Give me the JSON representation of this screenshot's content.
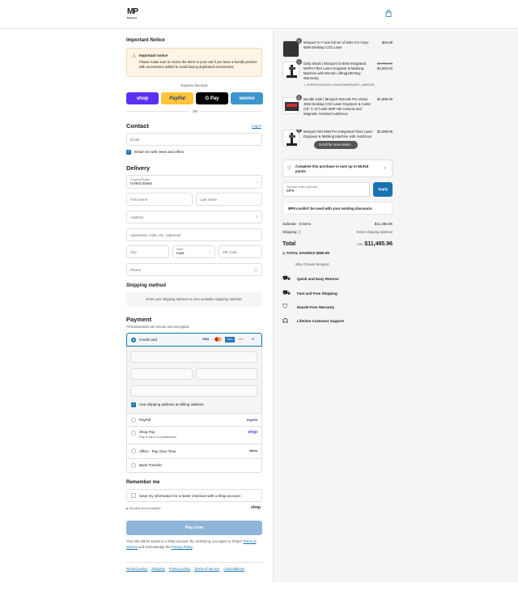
{
  "header": {
    "logo_mark": "MP",
    "logo_text": "Monport"
  },
  "notice": {
    "heading": "Important Notice",
    "box_title": "Important notice",
    "box_text": "Please make sure to review the items in your cart if you have a bundle product with accessories added to avoid buying duplicated accessories."
  },
  "express": {
    "label": "Express checkout",
    "or": "OR",
    "shop": "shop",
    "paypal": "PayPal",
    "gpay": "G Pay",
    "venmo": "venmo"
  },
  "contact": {
    "heading": "Contact",
    "login": "Log in",
    "email_placeholder": "Email",
    "news_label": "Email me with news and offers"
  },
  "delivery": {
    "heading": "Delivery",
    "country_label": "Country/Region",
    "country": "United States",
    "first": "First name",
    "last": "Last name",
    "address": "Address",
    "apt": "Apartment, suite, etc. (optional)",
    "city": "City",
    "state_label": "State",
    "state": "Iowa",
    "zip": "ZIP code",
    "phone": "Phone"
  },
  "shipping": {
    "heading": "Shipping method",
    "msg": "Enter your shipping address to view available shipping methods."
  },
  "payment": {
    "heading": "Payment",
    "sub": "All transactions are secure and encrypted.",
    "credit": "Credit card",
    "cards": [
      "VISA",
      "MC",
      "AMEX",
      "DISC",
      "+4"
    ],
    "billing": "Use shipping address as billing address.",
    "paypal": "PayPal",
    "paypal_logo": "PayPal",
    "shoppay": "Shop Pay",
    "shoppay_sub": "Pay in full or in installments",
    "shoppay_logo": "shop",
    "affirm": "Affirm - Pay Over Time",
    "affirm_logo": "affirm",
    "bank": "Bank Transfer"
  },
  "remember": {
    "heading": "Remember me",
    "label": "Save my information for a faster checkout with a Shop account",
    "secure": "Secured and encrypted",
    "shop": "shop"
  },
  "paynow": "Pay now",
  "legal": {
    "text1": "Your info will be saved to a Shop account. By continuing, you agree to Shop's",
    "tos": "Terms of Service",
    "text2": "and acknowledge the",
    "privacy": "Privacy Policy",
    "end": "."
  },
  "footer": [
    "Refund policy",
    "Shipping",
    "Privacy policy",
    "Terms of service",
    "Cancellations"
  ],
  "cart": [
    {
      "qty": "1",
      "name": "Monport X-Y axis full set of belts For Onyx 55W Desktop CO2 Laser",
      "price": "$45.99"
    },
    {
      "qty": "1",
      "name": "Daily Deals | Monport GI 60W Integrated MOPA Fiber Laser Engraver & Marking Machine with Electric Lifting(180-Day Warranty)",
      "old": "$4,759.99",
      "price": "$3,840.00",
      "discount": "SUPERCODE20% 1000AYSWARRANTY (-$959.99)"
    },
    {
      "qty": "1",
      "name": "Bundle Sale | Monport Reno45 Pro Vision 45W Desktop CO2 Laser Engraver & Cutter (16\" X 12\") with 6MP HD Camera and Magnetic Assisted Autofocus",
      "price": "$1,899.99"
    },
    {
      "qty": "1",
      "name": "Monport GM 50W Pro Integrated Fiber Laser Engraver & Marking Machine with Autofocus",
      "price": "$2,599.99",
      "more": "Scroll for more items"
    }
  ],
  "points": "Complete this purchase to earn up to 68,916 points",
  "discount": {
    "label": "Discount code or gift card",
    "value": "MP6",
    "apply": "Apply",
    "error": "MP6 couldn't be used with your existing discounts."
  },
  "totals": {
    "subtotal_label": "Subtotal · 5 items",
    "subtotal": "$11,485.96",
    "shipping_label": "Shipping",
    "shipping": "Enter shipping address",
    "total_label": "Total",
    "currency": "USD",
    "total": "$11,485.96",
    "savings_label": "TOTAL SAVINGS",
    "savings": "$959.99"
  },
  "why": {
    "heading": "Why Choose Monport",
    "items": [
      "Quick and Easy Returns",
      "Fast and Free Shipping",
      "Hassle-Free Warranty",
      "Lifetime Customer Support"
    ]
  }
}
